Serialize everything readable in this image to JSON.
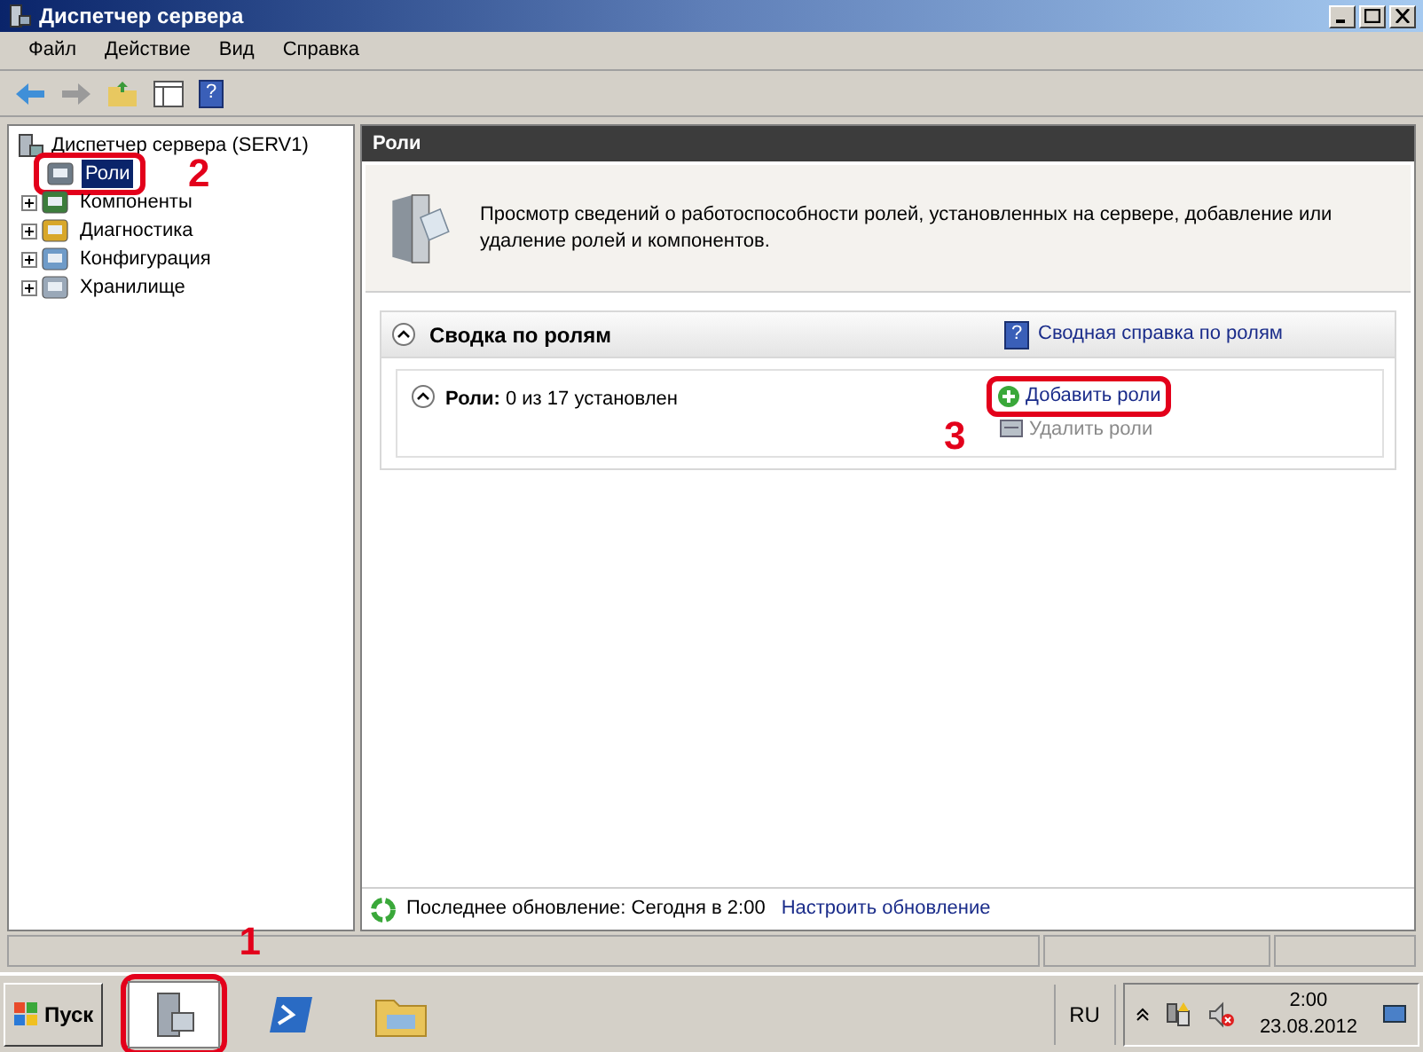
{
  "window": {
    "title": "Диспетчер сервера"
  },
  "menu": [
    "Файл",
    "Действие",
    "Вид",
    "Справка"
  ],
  "toolbar": {
    "help_glyph": "?"
  },
  "tree": {
    "label": "Диспетчер сервера (SERV1)",
    "expanded": true,
    "children": [
      {
        "label": "Роли",
        "selected": true,
        "expandable": false,
        "annotation": "2"
      },
      {
        "label": "Компоненты",
        "selected": false,
        "expandable": true
      },
      {
        "label": "Диагностика",
        "selected": false,
        "expandable": true
      },
      {
        "label": "Конфигурация",
        "selected": false,
        "expandable": true
      },
      {
        "label": "Хранилище",
        "selected": false,
        "expandable": true
      }
    ]
  },
  "pane": {
    "title": "Роли",
    "description": "Просмотр сведений о работоспособности ролей, установленных на сервере, добавление или удаление ролей и компонентов.",
    "summary": {
      "title": "Сводка по ролям",
      "expanded": true,
      "help_glyph": "?",
      "help_link": "Сводная справка по ролям",
      "roles": {
        "text": "**Роли:** 0 из 17 установлен",
        "expanded": true,
        "actions": [
          {
            "label": "Добавить роли",
            "kind": "add",
            "disabled": false,
            "annotation": "3"
          },
          {
            "label": "Удалить роли",
            "kind": "remove",
            "disabled": true
          }
        ]
      }
    }
  },
  "refresh": {
    "text": "Последнее обновление: Сегодня в 2:00",
    "link": "Настроить обновление"
  },
  "taskbar": {
    "start": "Пуск",
    "apps": [
      {
        "kind": "server",
        "selected": true,
        "annotation": "1"
      },
      {
        "kind": "shell",
        "selected": false
      },
      {
        "kind": "folder",
        "selected": false
      }
    ],
    "language": "RU",
    "time": "2:00",
    "date": "23.08.2012"
  }
}
